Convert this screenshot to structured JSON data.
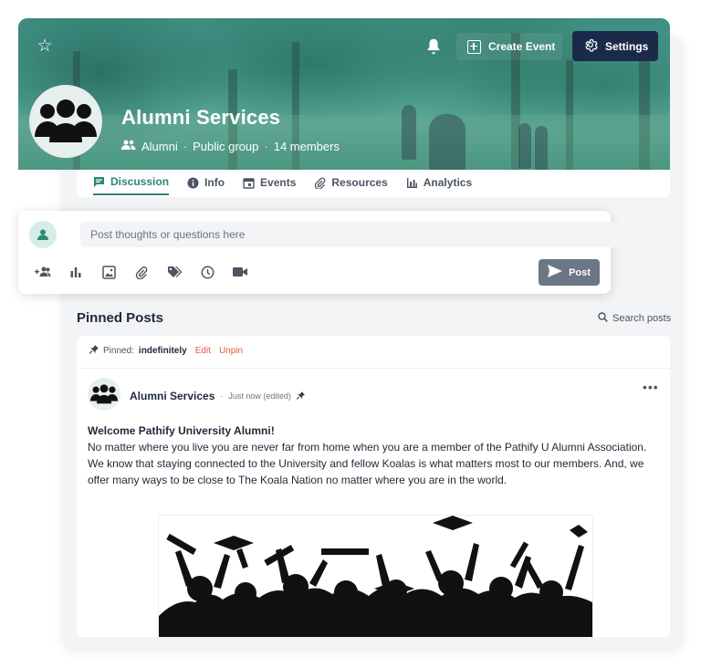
{
  "header": {
    "create_event_label": "Create Event",
    "settings_label": "Settings"
  },
  "group": {
    "title": "Alumni Services",
    "category": "Alumni",
    "privacy": "Public group",
    "members": "14 members",
    "separator": "·"
  },
  "tabs": [
    {
      "label": "Discussion",
      "icon": "chat-icon",
      "active": true
    },
    {
      "label": "Info",
      "icon": "info-icon",
      "active": false
    },
    {
      "label": "Events",
      "icon": "calendar-icon",
      "active": false
    },
    {
      "label": "Resources",
      "icon": "paperclip-icon",
      "active": false
    },
    {
      "label": "Analytics",
      "icon": "bar-chart-icon",
      "active": false
    }
  ],
  "composer": {
    "placeholder": "Post thoughts or questions here",
    "tools": [
      "add-people-icon",
      "poll-icon",
      "image-icon",
      "attachment-icon",
      "tag-icon",
      "clock-icon",
      "video-icon"
    ],
    "post_label": "Post"
  },
  "pinned": {
    "title": "Pinned Posts",
    "search_label": "Search posts",
    "pinned_prefix": "Pinned:",
    "pinned_duration": "indefinitely",
    "edit_label": "Edit",
    "unpin_label": "Unpin"
  },
  "post": {
    "author": "Alumni Services",
    "separator": "·",
    "time": "Just now (edited)",
    "heading": "Welcome Pathify University Alumni!",
    "body": "No matter where you live you are never far from home when you are a member of the Pathify U Alumni Association. We know that staying connected to the University and fellow Koalas is what matters most to our members. And, we offer many ways to be close to The Koala Nation no matter where you are in the world.",
    "more_label": "•••"
  },
  "colors": {
    "accent": "#2d8676",
    "settings_bg": "#1c2a4a",
    "danger": "#e35b3e",
    "post_button": "#6b7686"
  }
}
